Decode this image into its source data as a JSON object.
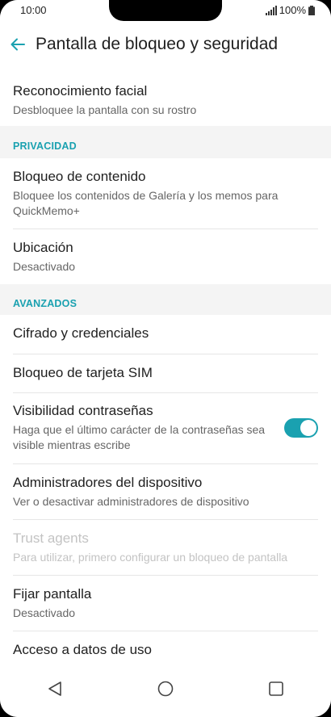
{
  "status_bar": {
    "time": "10:00",
    "battery": "100%",
    "icons": [
      "signal-icon",
      "battery-icon"
    ]
  },
  "header": {
    "back_icon": "arrow-left-icon",
    "title": "Pantalla de bloqueo y seguridad"
  },
  "colors": {
    "accent": "#1aa1b0",
    "section_background": "#f4f4f4",
    "primary_text": "#1f1f1f",
    "secondary_text": "#666666",
    "disabled_text": "#c3c3c3"
  },
  "items": {
    "facial": {
      "title": "Reconocimiento facial",
      "subtitle": "Desbloquee la pantalla con su rostro"
    },
    "contenido": {
      "title": "Bloqueo de contenido",
      "subtitle": "Bloquee los contenidos de Galería y los memos para QuickMemo+"
    },
    "ubicacion": {
      "title": "Ubicación",
      "subtitle": "Desactivado"
    },
    "cifrado": {
      "title": "Cifrado y credenciales"
    },
    "sim": {
      "title": "Bloqueo de tarjeta SIM"
    },
    "visibilidad": {
      "title": "Visibilidad contraseñas",
      "subtitle": "Haga que el último carácter de la contraseñas sea visible mientras escribe",
      "toggle_on": true
    },
    "administradores": {
      "title": "Administradores del dispositivo",
      "subtitle": "Ver o desactivar administradores de dispositivo"
    },
    "trust": {
      "title": "Trust agents",
      "subtitle": "Para utilizar, primero configurar un bloqueo de pantalla",
      "enabled": false
    },
    "fijar": {
      "title": "Fijar pantalla",
      "subtitle": "Desactivado"
    },
    "acceso": {
      "title": "Acceso a datos de uso"
    }
  },
  "sections": {
    "privacidad": "PRIVACIDAD",
    "avanzados": "AVANZADOS"
  },
  "nav_bar": {
    "icons": [
      "back-triangle-icon",
      "home-circle-icon",
      "recents-square-icon"
    ]
  }
}
